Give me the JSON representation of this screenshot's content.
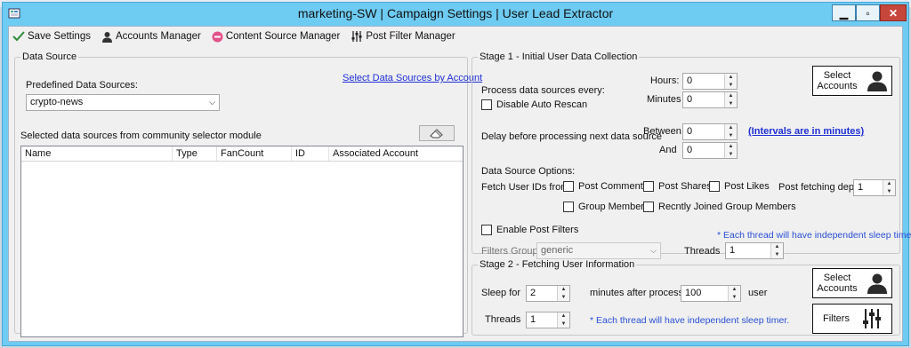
{
  "window": {
    "title": "marketing-SW | Campaign Settings | User Lead Extractor",
    "min_label": "▁",
    "max_label": "▫",
    "close_label": "✕"
  },
  "toolbar": {
    "save": "Save Settings",
    "accounts": "Accounts Manager",
    "content_source": "Content Source Manager",
    "post_filter": "Post Filter Manager"
  },
  "data_source": {
    "legend": "Data Source",
    "select_link": "Select Data Sources by Account",
    "predefined_label": "Predefined Data Sources:",
    "predefined_value": "crypto-news",
    "selected_label": "Selected data sources from community selector module",
    "columns": [
      "Name",
      "Type",
      "FanCount",
      "ID",
      "Associated Account"
    ],
    "rows": []
  },
  "stage1": {
    "legend": "Stage 1 - Initial User Data Collection",
    "process_label": "Process data sources every:",
    "hours_label": "Hours:",
    "hours_value": "0",
    "minutes_label": "Minutes",
    "minutes_value": "0",
    "disable_rescan": "Disable Auto Rescan",
    "delay_label": "Delay before processing next data source",
    "between_label": "Between",
    "between_value": "0",
    "and_label": "And",
    "and_value": "0",
    "intervals_link": "(Intervals are in minutes)",
    "options_label": "Data Source Options:",
    "fetch_label": "Fetch User IDs from:",
    "post_comments": "Post Comments",
    "post_shares": "Post Shares",
    "post_likes": "Post Likes",
    "fetch_depth_label": "Post fetching depth",
    "fetch_depth_value": "1",
    "group_members": "Group Members",
    "recently_joined": "Recntly Joined Group Members",
    "enable_filters": "Enable Post Filters",
    "thread_note": "* Each thread will have independent sleep timer.",
    "filters_group_label": "Filters Group :",
    "filters_group_value": "generic",
    "threads_label": "Threads",
    "threads_value": "1",
    "select_accounts": "Select\nAccounts"
  },
  "stage2": {
    "legend": "Stage 2 - Fetching User Information",
    "sleep_label": "Sleep for",
    "sleep_value": "2",
    "after_label": "minutes after processing",
    "user_value": "100",
    "user_label": "user",
    "threads_label": "Threads",
    "threads_value": "1",
    "thread_note": "* Each thread will have independent sleep timer.",
    "select_accounts": "Select\nAccounts",
    "filters_label": "Filters"
  },
  "colors": {
    "titlebar": "#6ecbf2",
    "link": "#1f2fd6",
    "close": "#c7463b"
  }
}
